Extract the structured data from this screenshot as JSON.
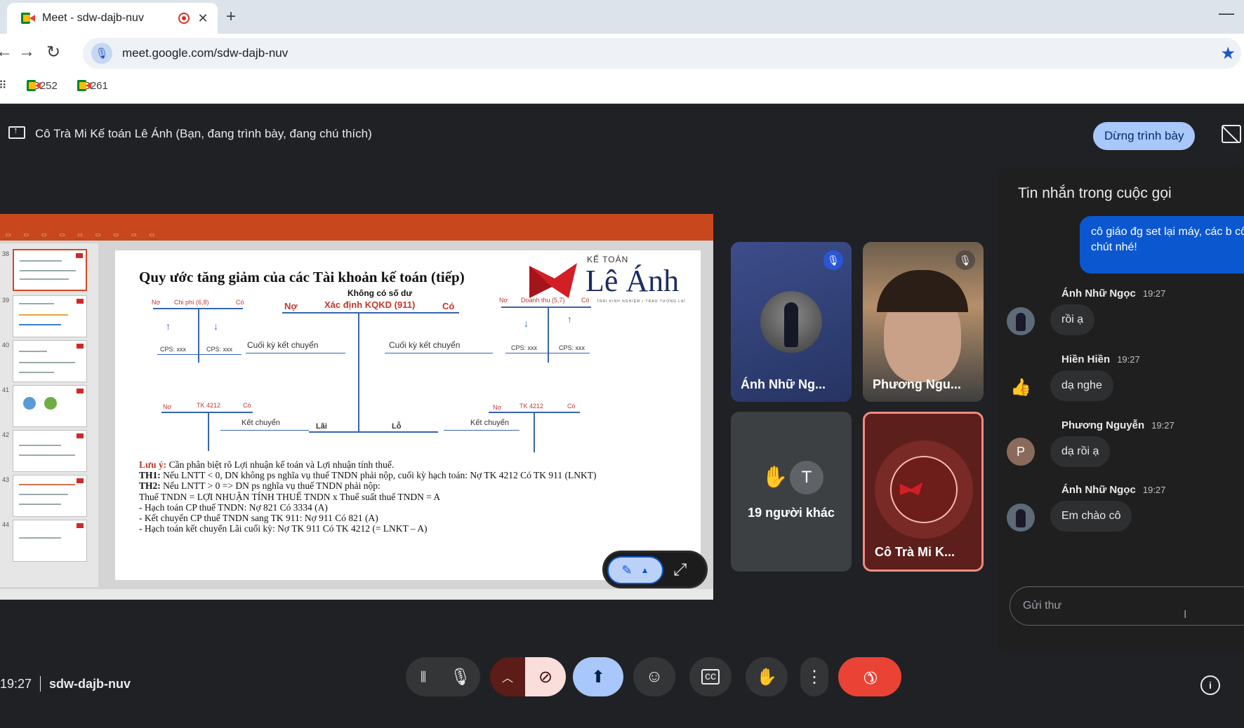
{
  "browser": {
    "tab_title": "Meet - sdw-dajb-nuv",
    "url": "meet.google.com/sdw-dajb-nuv",
    "bookmarks": [
      "C252",
      "C261"
    ]
  },
  "meet": {
    "presenting_text": "Cô Trà Mi Kế toán Lê Ánh (Bạn, đang trình bày, đang chú thích)",
    "stop_presenting": "Dừng trình bày",
    "time": "19:27",
    "meeting_code": "sdw-dajb-nuv"
  },
  "slide": {
    "title": "Quy ước tăng giảm của các Tài khoản kế toán (tiếp)",
    "logo_small": "KẾ TOÁN",
    "logo_big": "Lê Ánh",
    "logo_tag": "TRẢI KINH NGHIỆM • TRAO TƯƠNG LAI",
    "no_balance": "Không có số dư",
    "no": "Nợ",
    "co": "Có",
    "kqkd": "Xác định KQKD (911)",
    "chi_phi": "Chi phí (6,8)",
    "doanh_thu": "Doanh thu (5,7)",
    "cps": "CPS: xxx",
    "cuoi_ky": "Cuối kỳ kết chuyển",
    "tk4212": "TK 4212",
    "ket_chuyen": "Kết chuyển",
    "lai": "Lãi",
    "lo": "Lỗ",
    "notes": {
      "label": "Lưu ý:",
      "l1": " Cần phân biệt rõ Lợi nhuận kế toán và Lợi nhuận tính thuế.",
      "th1_label": "TH1:",
      "th1": " Nếu LNTT < 0, DN không ps nghĩa vụ thuế TNDN phải nộp, cuối kỳ hạch toán: Nợ TK 4212      Có TK 911 (LNKT)",
      "th2_label": "TH2:",
      "th2": " Nếu LNTT > 0 => DN ps nghĩa vụ thuế TNDN phải nộp:",
      "l4": "Thuế TNDN = LỢI NHUẬN TÍNH THUẾ TNDN x Thuế suất thuế TNDN = A",
      "l5": "- Hạch toán CP thuế TNDN: Nợ 821 Có 3334  (A)",
      "l6": "- Kết chuyển CP thuế TNDN sang TK 911: Nợ 911   Có 821  (A)",
      "l7": "- Hạch toán kết chuyển Lãi cuối kỳ: Nợ TK 911      Có TK 4212 (= LNKT – A)"
    },
    "thumb_numbers": [
      "38",
      "39",
      "40",
      "41",
      "42",
      "43",
      "44"
    ]
  },
  "participants": [
    {
      "name": "Ánh Nhữ Ng...",
      "muted": true
    },
    {
      "name": "Phương Ngu...",
      "muted": true
    },
    {
      "name": "19 người khác",
      "initial": "T"
    },
    {
      "name": "Cô Trà Mi K..."
    }
  ],
  "chat": {
    "title": "Tin nhắn trong cuộc gọi",
    "my_message": "cô giáo đg set lại máy, các b cô chút nhé!",
    "messages": [
      {
        "name": "Ánh Nhữ Ngọc",
        "time": "19:27",
        "text": "rồi ạ"
      },
      {
        "name": "Hiền Hiền",
        "time": "19:27",
        "text": "dạ nghe"
      },
      {
        "name": "Phương Nguyễn",
        "time": "19:27",
        "text": "dạ rồi ạ",
        "initial": "P"
      },
      {
        "name": "Ánh Nhữ Ngọc",
        "time": "19:27",
        "text": "Em chào cô"
      }
    ],
    "input_placeholder": "Gửi thư"
  },
  "colors": {
    "meet_bg": "#202124",
    "accent_blue": "#a8c7fa",
    "end_call_red": "#ea4335",
    "ppt_orange": "#c8471c"
  }
}
